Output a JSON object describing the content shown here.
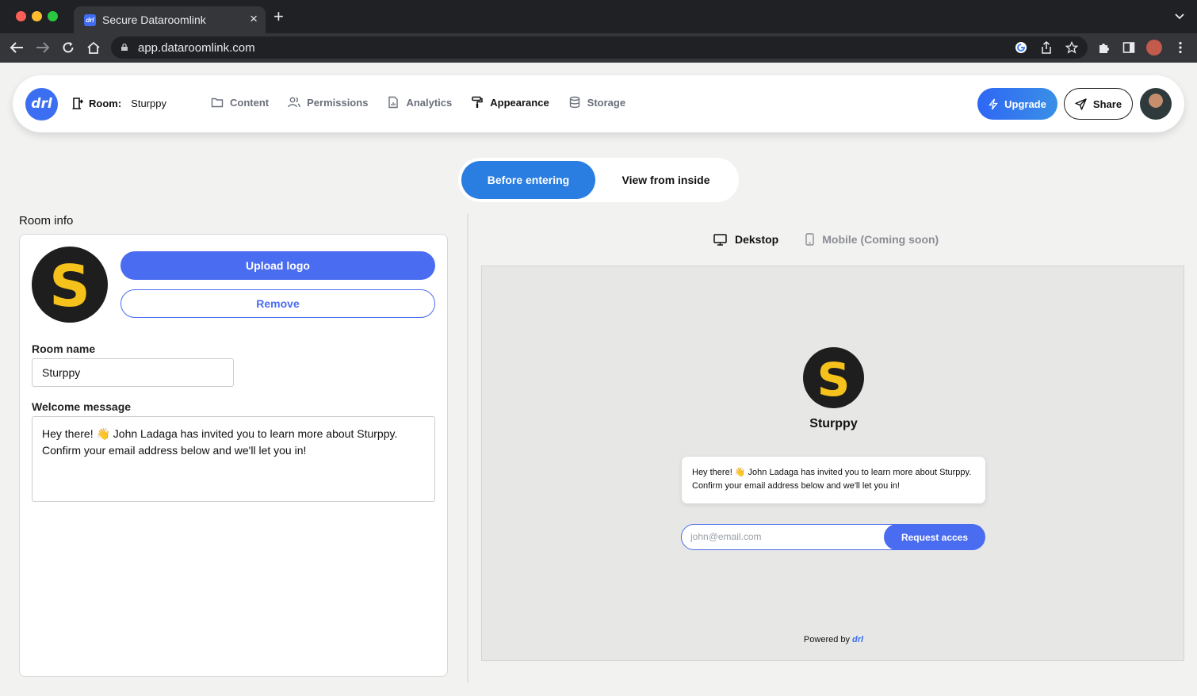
{
  "browser": {
    "tab_title": "Secure Dataroomlink",
    "tab_favicon": "drl",
    "url": "app.dataroomlink.com"
  },
  "header": {
    "logo_text": "drl",
    "room_label": "Room:",
    "room_name": "Sturppy",
    "nav": [
      {
        "label": "Content",
        "icon": "folder-icon",
        "active": false
      },
      {
        "label": "Permissions",
        "icon": "users-icon",
        "active": false
      },
      {
        "label": "Analytics",
        "icon": "document-chart-icon",
        "active": false
      },
      {
        "label": "Appearance",
        "icon": "paint-roller-icon",
        "active": true
      },
      {
        "label": "Storage",
        "icon": "database-icon",
        "active": false
      }
    ],
    "upgrade_label": "Upgrade",
    "share_label": "Share"
  },
  "mode_toggle": {
    "active_label": "Before entering",
    "inactive_label": "View from inside"
  },
  "room_info": {
    "section_title": "Room info",
    "logo_letter": "S",
    "upload_label": "Upload logo",
    "remove_label": "Remove",
    "room_name_label": "Room name",
    "room_name_value": "Sturppy",
    "welcome_label": "Welcome message",
    "welcome_value": "Hey there! 👋 John Ladaga has invited you to learn more about Sturppy. Confirm your email address below and we'll let you in!"
  },
  "preview": {
    "desktop_label": "Dekstop",
    "mobile_label": "Mobile (Coming soon)",
    "logo_letter": "S",
    "room_name": "Sturppy",
    "message": "Hey there! 👋 John Ladaga has invited you to learn more about Sturppy. Confirm your email address below and we'll let you in!",
    "email_placeholder": "john@email.com",
    "request_label": "Request acces",
    "powered_by": "Powered by",
    "powered_brand": "drl"
  },
  "colors": {
    "accent": "#4a6cf0",
    "toggle_active": "#2a7de1",
    "logo_yellow": "#f5c21b",
    "logo_dark": "#1e1e1e"
  }
}
